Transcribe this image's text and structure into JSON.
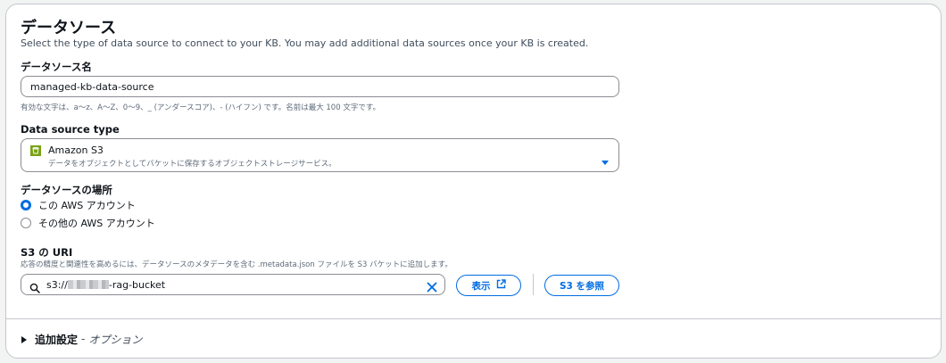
{
  "section": {
    "title": "データソース",
    "description": "Select the type of data source to connect to your KB. You may add additional data sources once your KB is created."
  },
  "name_field": {
    "label": "データソース名",
    "value": "managed-kb-data-source",
    "hint": "有効な文字は、a〜z、A〜Z、0〜9、_ (アンダースコア)、- (ハイフン) です。名前は最大 100 文字です。"
  },
  "source_type": {
    "label": "Data source type",
    "selected_title": "Amazon S3",
    "selected_description": "データをオブジェクトとしてバケットに保存するオブジェクトストレージサービス。",
    "icon": "s3-bucket-icon"
  },
  "location": {
    "label": "データソースの場所",
    "options": [
      {
        "label": "この AWS アカウント",
        "checked": true
      },
      {
        "label": "その他の AWS アカウント",
        "checked": false
      }
    ]
  },
  "s3_uri": {
    "label": "S3 の URI",
    "hint": "応答の精度と関連性を高めるには、データソースのメタデータを含む .metadata.json ファイルを S3 バケットに追加します。",
    "value_prefix": "s3://",
    "value_suffix": "-rag-bucket",
    "view_button": "表示",
    "browse_button": "S3 を参照"
  },
  "advanced": {
    "title": "追加設定",
    "separator": "-",
    "subtitle": "オプション"
  },
  "colors": {
    "accent": "#006ce0",
    "s3_green": "#7aa116",
    "border": "#8c8c94"
  }
}
